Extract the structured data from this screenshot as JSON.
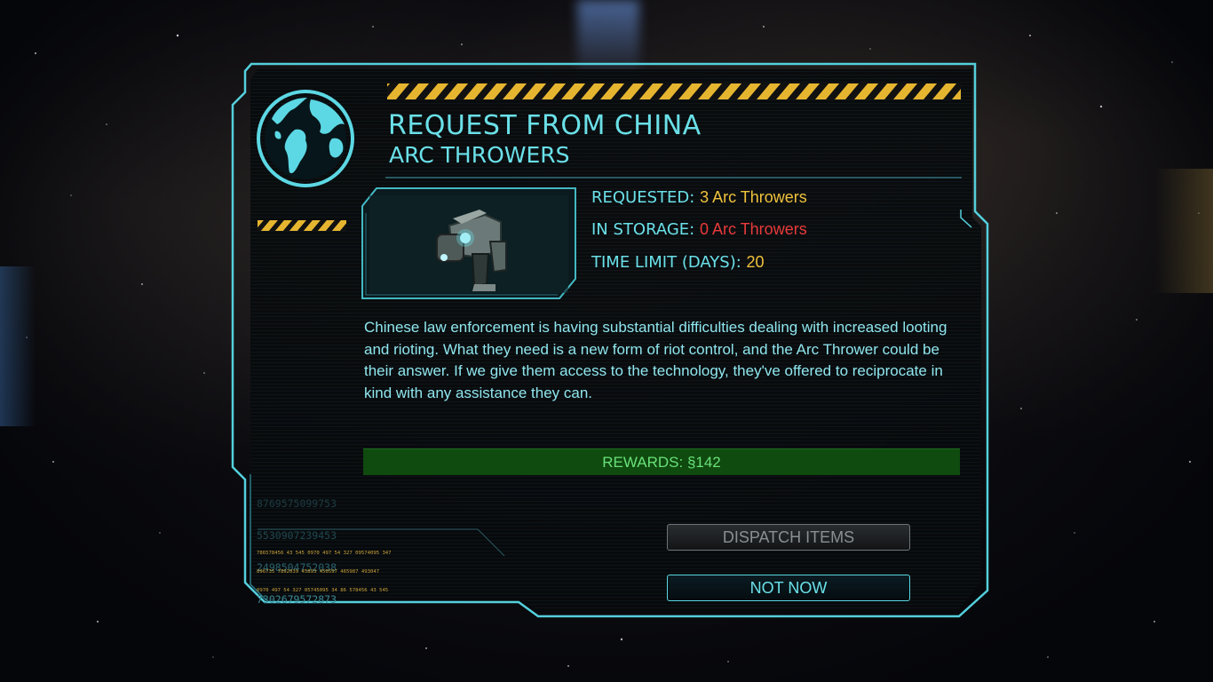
{
  "dialog": {
    "title": "REQUEST FROM CHINA",
    "subtitle": "ARC THROWERS"
  },
  "stats": {
    "requested_label": "REQUESTED:",
    "requested_value": "3 Arc Throwers",
    "storage_label": "IN STORAGE:",
    "storage_value": "0 Arc Throwers",
    "time_label": "TIME LIMIT (DAYS):",
    "time_value": "20"
  },
  "description": "Chinese law enforcement is having substantial difficulties dealing with increased looting and rioting. What they need is a new form of riot control, and the Arc Thrower could be their answer. If we give them access to the technology, they've offered to reciprocate in kind with any assistance they can.",
  "rewards": "REWARDS: §142",
  "buttons": {
    "dispatch": "DISPATCH ITEMS",
    "not_now": "NOT NOW"
  },
  "decor_codes": [
    "8769575099753",
    "5530907239453",
    "2498504752038",
    "7302679572873"
  ],
  "decor_small_codes": [
    "786578456 43 545 0970 497 54 327 09574095 347",
    "896735 7892039 45893 450597 465987 493047",
    "0970 497 54 327 05745095 34 86 578456 43 545"
  ],
  "colors": {
    "accent_cyan": "#6ae0e8",
    "value_yellow": "#f0c23c",
    "value_red": "#e83a3a",
    "reward_green": "#69e07a",
    "hazard_yellow": "#e6b530"
  },
  "icons": {
    "globe": "globe-icon",
    "item": "arc-thrower-image"
  }
}
